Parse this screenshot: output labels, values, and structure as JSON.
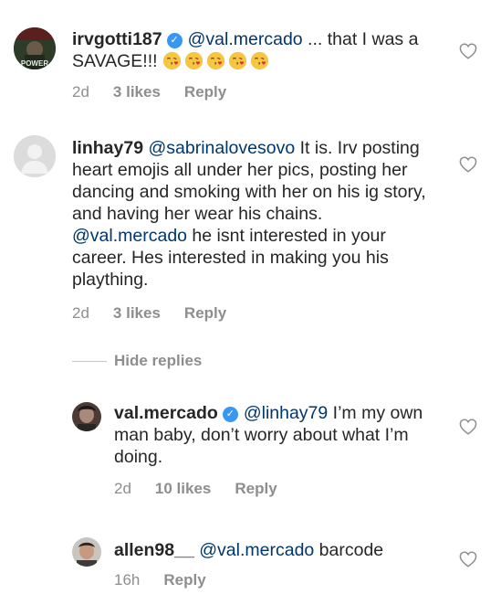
{
  "comments": [
    {
      "username": "irvgotti187",
      "verified": true,
      "mention": "@val.mercado",
      "text": " ... that I was a SAVAGE!!! ",
      "emoji_count": 5,
      "time": "2d",
      "likes": "3 likes",
      "reply": "Reply",
      "avatar_text": "POWER"
    },
    {
      "username": "linhay79",
      "verified": false,
      "mention": "@sabrinalovesovo",
      "text_a": " It is. Irv posting heart emojis all under her pics, posting her dancing and smoking with her on his ig story, and having her wear his chains. ",
      "mention2": "@val.mercado",
      "text_b": " he isnt interested in your career. Hes interested in making you his plaything.",
      "time": "2d",
      "likes": "3 likes",
      "reply": "Reply"
    },
    {
      "username": "val.mercado",
      "verified": true,
      "mention": "@linhay79",
      "text": " I’m my own man baby, don’t worry about what I’m doing.",
      "time": "2d",
      "likes": "10 likes",
      "reply": "Reply"
    },
    {
      "username": "allen98__",
      "verified": false,
      "mention": "@val.mercado",
      "text": " barcode",
      "time": "16h",
      "reply": "Reply"
    }
  ],
  "hide_replies": "Hide replies",
  "colors": {
    "text": "#262626",
    "mention": "#00376b",
    "meta": "#8e8e8e",
    "verified": "#3897f0",
    "divider": "#c7c7c7"
  },
  "icons": [
    "verified-badge-icon",
    "heart-icon",
    "face-blowing-kiss-emoji"
  ]
}
